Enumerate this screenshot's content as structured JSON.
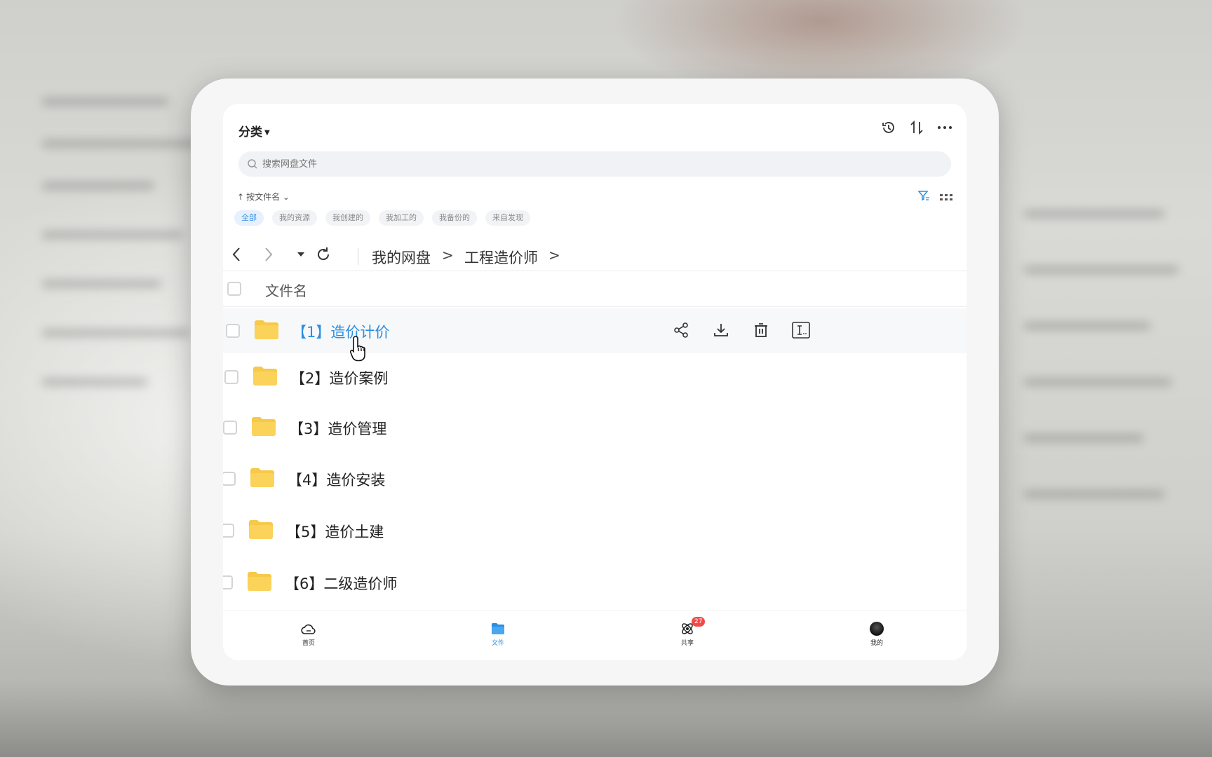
{
  "header": {
    "category_label": "分类",
    "search_placeholder": "搜索网盘文件",
    "sort_label": "按文件名"
  },
  "filters": [
    {
      "label": "全部",
      "active": true
    },
    {
      "label": "我的资源",
      "active": false
    },
    {
      "label": "我创建的",
      "active": false
    },
    {
      "label": "我加工的",
      "active": false
    },
    {
      "label": "我备份的",
      "active": false
    },
    {
      "label": "来自发现",
      "active": false
    }
  ],
  "breadcrumb": {
    "root": "我的网盘",
    "separator": ">",
    "current": "工程造价师",
    "trailing": ">"
  },
  "table": {
    "column_header": "文件名",
    "rows": [
      {
        "name": "【1】造价计价",
        "icon": "folder-icon",
        "hovered": true
      },
      {
        "name": "【2】造价案例",
        "icon": "folder-icon",
        "hovered": false
      },
      {
        "name": "【3】造价管理",
        "icon": "folder-icon",
        "hovered": false
      },
      {
        "name": "【4】造价安装",
        "icon": "folder-icon",
        "hovered": false
      },
      {
        "name": "【5】造价土建",
        "icon": "folder-icon",
        "hovered": false
      },
      {
        "name": "【6】二级造价师",
        "icon": "folder-icon",
        "hovered": false
      }
    ],
    "row_actions": [
      "share-icon",
      "download-icon",
      "delete-icon",
      "rename-icon"
    ]
  },
  "tabbar": {
    "items": [
      {
        "label": "首页",
        "icon": "cloud-home-icon",
        "active": false
      },
      {
        "label": "文件",
        "icon": "folder-tab-icon",
        "active": true
      },
      {
        "label": "共享",
        "icon": "share-tab-icon",
        "active": false,
        "badge": "27"
      },
      {
        "label": "我的",
        "icon": "avatar",
        "active": false
      }
    ]
  },
  "colors": {
    "accent": "#2a8ee0",
    "folder": "#f7c948",
    "badge": "#f04a4a"
  }
}
